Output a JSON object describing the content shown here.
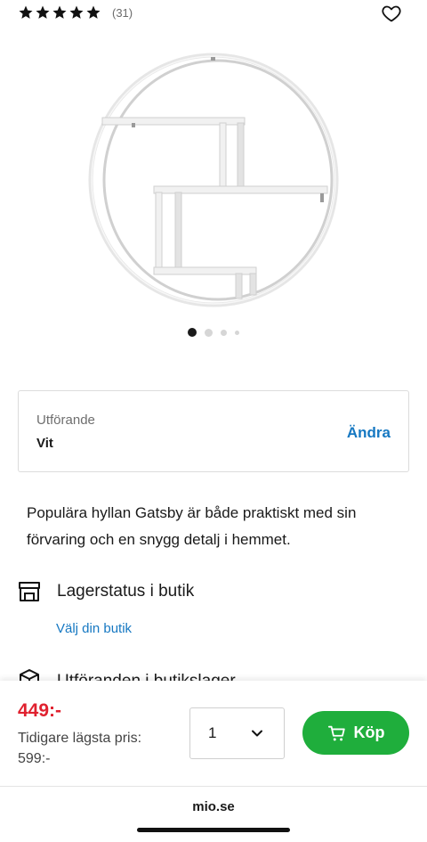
{
  "rating": {
    "stars": 5,
    "count_label": "(31)"
  },
  "icons": {
    "favorite": "heart-outline-icon",
    "store": "store-icon",
    "box": "box-icon",
    "cart": "cart-icon",
    "chevron": "chevron-down-icon"
  },
  "gallery": {
    "image_alt": "Gatsby vägghylla",
    "total_slides": 4,
    "active_slide": 1
  },
  "variant": {
    "label": "Utförande",
    "value": "Vit",
    "change_label": "Ändra"
  },
  "description": "Populära hyllan Gatsby är både praktiskt med sin förvaring och en snygg detalj i hemmet.",
  "stock": {
    "title": "Lagerstatus i butik",
    "choose_store_label": "Välj din butik"
  },
  "store_variants": {
    "title": "Utföranden i butikslager"
  },
  "purchase": {
    "price": "449:-",
    "previous_price_label": "Tidigare lägsta pris: 599:-",
    "quantity": "1",
    "buy_label": "Köp"
  },
  "browser": {
    "url": "mio.se"
  },
  "colors": {
    "price_red": "#e0212f",
    "link_blue": "#1678c2",
    "buy_green": "#1fae3c"
  }
}
